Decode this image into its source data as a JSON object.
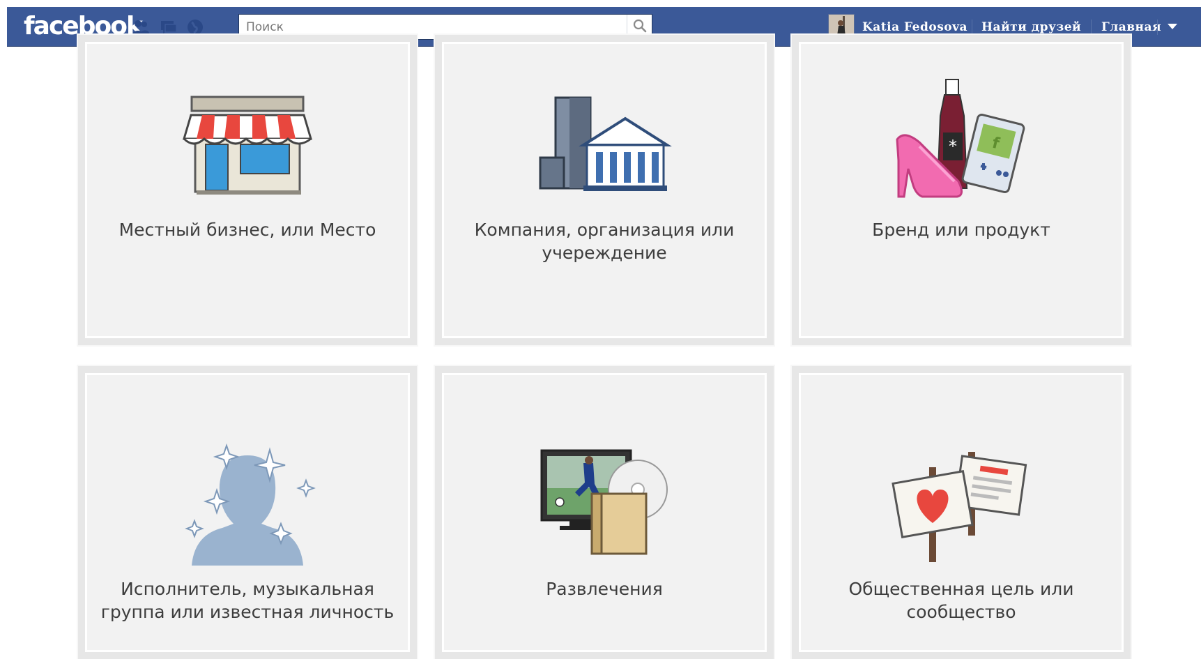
{
  "header": {
    "logo_text": "facebook",
    "search_placeholder": "Поиск",
    "user_name": "Katia Fedosova",
    "find_friends": "Найти друзей",
    "home": "Главная",
    "colors": {
      "bar": "#3b5998"
    }
  },
  "icons": {
    "friend_requests": "friends-icon",
    "messages": "messages-icon",
    "notifications": "globe-icon",
    "search": "magnifier-icon",
    "menu": "chevron-down-icon"
  },
  "categories": [
    {
      "label": "Местный бизнес, или Место",
      "icon": "storefront-icon"
    },
    {
      "label": "Компания, организация или учереждение",
      "icon": "company-buildings-icon"
    },
    {
      "label": "Бренд или продукт",
      "icon": "brand-product-icon"
    },
    {
      "label": "Исполнитель, музыкальная группа или известная личность",
      "icon": "celebrity-icon"
    },
    {
      "label": "Развлечения",
      "icon": "entertainment-icon"
    },
    {
      "label": "Общественная цель или сообщество",
      "icon": "cause-signs-icon"
    }
  ]
}
